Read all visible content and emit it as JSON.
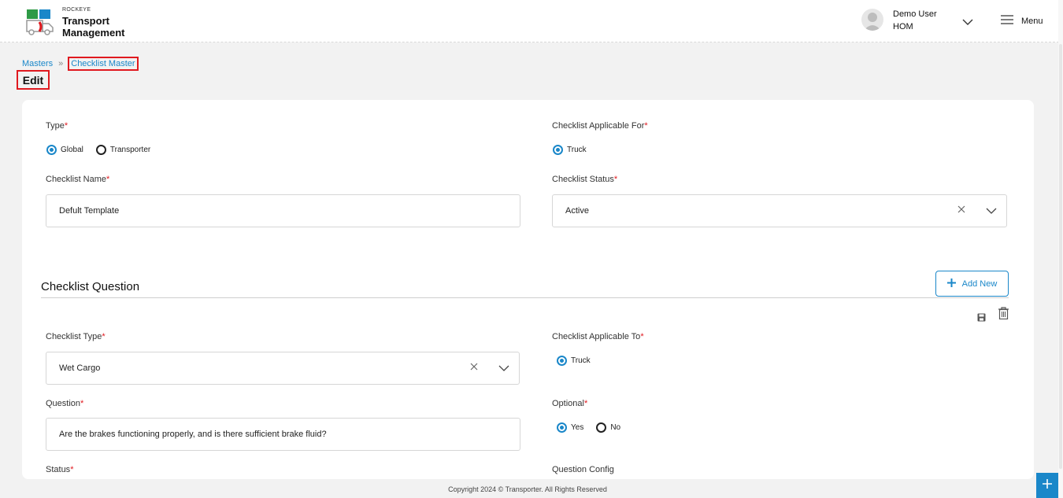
{
  "app": {
    "brand_small": "ROCKEYE",
    "brand_line1": "Transport",
    "brand_line2": "Management"
  },
  "user": {
    "name": "Demo User",
    "org": "HOM"
  },
  "menu": {
    "label": "Menu"
  },
  "breadcrumb": {
    "root": "Masters",
    "current": "Checklist Master"
  },
  "page": {
    "title": "Edit"
  },
  "form": {
    "type": {
      "label": "Type",
      "options": [
        "Global",
        "Transporter"
      ],
      "selected": "Global"
    },
    "applicable_for": {
      "label": "Checklist Applicable For",
      "options": [
        "Truck"
      ],
      "selected": "Truck"
    },
    "checklist_name": {
      "label": "Checklist Name",
      "value": "Defult Template"
    },
    "checklist_status": {
      "label": "Checklist Status",
      "value": "Active"
    },
    "required_mark": "*"
  },
  "questions": {
    "section_title": "Checklist Question",
    "add_new_label": "Add New",
    "checklist_type": {
      "label": "Checklist Type",
      "value": "Wet Cargo"
    },
    "applicable_to": {
      "label": "Checklist Applicable To",
      "options": [
        "Truck"
      ],
      "selected": "Truck"
    },
    "question": {
      "label": "Question",
      "value": "Are the brakes functioning properly, and is there sufficient brake fluid?"
    },
    "optional": {
      "label": "Optional",
      "options": [
        "Yes",
        "No"
      ],
      "selected": "Yes"
    },
    "status": {
      "label": "Status"
    },
    "question_config": {
      "label": "Question Config"
    }
  },
  "footer": {
    "copyright": "Copyright 2024 © Transporter. All Rights Reserved"
  },
  "colors": {
    "accent": "#1a87c9",
    "required": "#e0191f",
    "highlight_box": "#e0191f"
  },
  "icons": [
    "logo-icon",
    "avatar-icon",
    "chevron-down-icon",
    "hamburger-icon",
    "close-icon",
    "plus-icon",
    "save-icon",
    "trash-icon"
  ]
}
